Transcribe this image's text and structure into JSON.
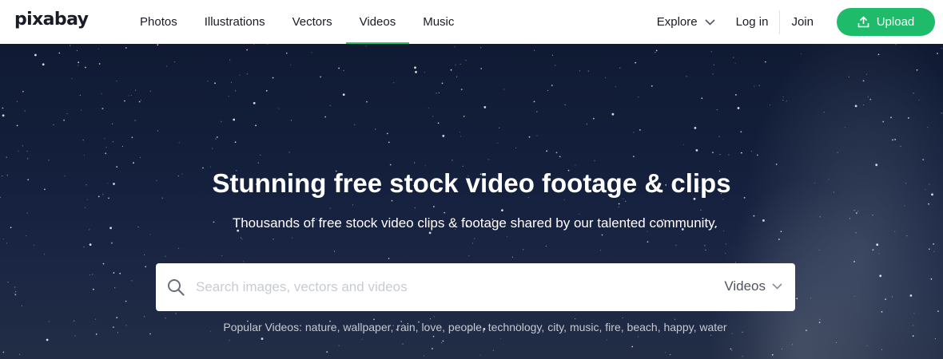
{
  "brand": {
    "logo_text": "pixabay"
  },
  "nav": {
    "tabs": [
      {
        "label": "Photos",
        "active": false
      },
      {
        "label": "Illustrations",
        "active": false
      },
      {
        "label": "Vectors",
        "active": false
      },
      {
        "label": "Videos",
        "active": true
      },
      {
        "label": "Music",
        "active": false
      }
    ],
    "explore_label": "Explore",
    "login_label": "Log in",
    "join_label": "Join",
    "upload_label": "Upload"
  },
  "hero": {
    "title": "Stunning free stock video footage & clips",
    "subtitle": "Thousands of free stock video clips & footage shared by our talented community."
  },
  "search": {
    "placeholder": "Search images, vectors and videos",
    "value": "",
    "type_selected": "Videos"
  },
  "popular": {
    "label": "Popular Videos:",
    "tags": [
      "nature",
      "wallpaper",
      "rain",
      "love",
      "people",
      "technology",
      "city",
      "music",
      "fire",
      "beach",
      "happy",
      "water"
    ]
  },
  "colors": {
    "accent": "#1ebc6a",
    "hero_bg": "#14203d"
  },
  "icons": {
    "search": "search-icon",
    "explore": "chevron-down-icon",
    "upload": "upload-icon",
    "type": "chevron-down-icon"
  }
}
